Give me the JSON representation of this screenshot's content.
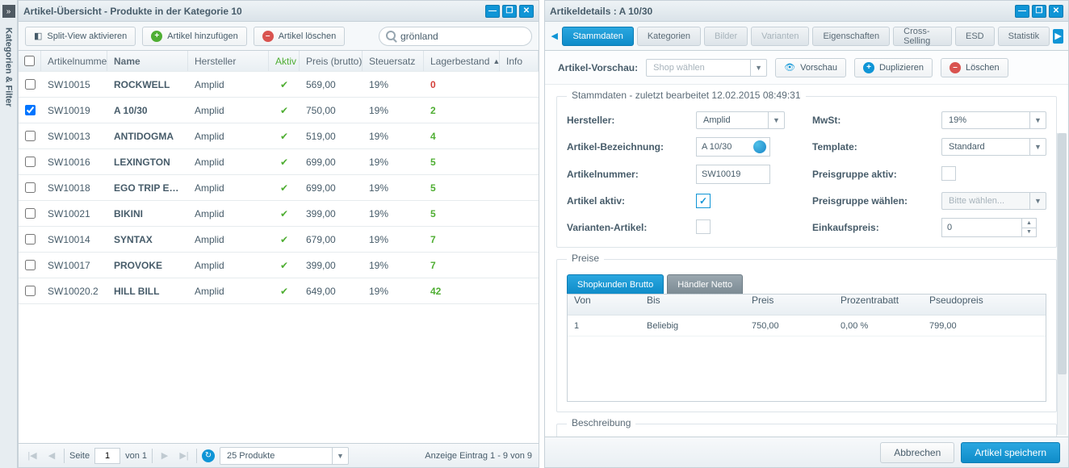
{
  "sidebar": {
    "label": "Kategorien & Filter"
  },
  "leftWindow": {
    "title": "Artikel-Übersicht - Produkte in der Kategorie 10",
    "toolbar": {
      "splitview": "Split-View aktivieren",
      "add": "Artikel hinzufügen",
      "delete": "Artikel löschen",
      "search_value": "grönland"
    },
    "columns": {
      "num": "Artikelnummer",
      "name": "Name",
      "her": "Hersteller",
      "aktiv": "Aktiv",
      "preis": "Preis (brutto)",
      "steuer": "Steuersatz",
      "lager": "Lagerbestand",
      "info": "Info"
    },
    "rows": [
      {
        "num": "SW10015",
        "name": "ROCKWELL",
        "her": "Amplid",
        "aktiv": true,
        "preis": "569,00",
        "steuer": "19%",
        "lager": "0",
        "stock": "red",
        "checked": false
      },
      {
        "num": "SW10019",
        "name": "A 10/30",
        "her": "Amplid",
        "aktiv": true,
        "preis": "750,00",
        "steuer": "19%",
        "lager": "2",
        "stock": "green",
        "checked": true
      },
      {
        "num": "SW10013",
        "name": "ANTIDOGMA",
        "her": "Amplid",
        "aktiv": true,
        "preis": "519,00",
        "steuer": "19%",
        "lager": "4",
        "stock": "green",
        "checked": false
      },
      {
        "num": "SW10016",
        "name": "LEXINGTON",
        "her": "Amplid",
        "aktiv": true,
        "preis": "699,00",
        "steuer": "19%",
        "lager": "5",
        "stock": "green",
        "checked": false
      },
      {
        "num": "SW10018",
        "name": "EGO TRIP EVO...",
        "her": "Amplid",
        "aktiv": true,
        "preis": "699,00",
        "steuer": "19%",
        "lager": "5",
        "stock": "green",
        "checked": false
      },
      {
        "num": "SW10021",
        "name": "BIKINI",
        "her": "Amplid",
        "aktiv": true,
        "preis": "399,00",
        "steuer": "19%",
        "lager": "5",
        "stock": "green",
        "checked": false
      },
      {
        "num": "SW10014",
        "name": "SYNTAX",
        "her": "Amplid",
        "aktiv": true,
        "preis": "679,00",
        "steuer": "19%",
        "lager": "7",
        "stock": "green",
        "checked": false
      },
      {
        "num": "SW10017",
        "name": "PROVOKE",
        "her": "Amplid",
        "aktiv": true,
        "preis": "399,00",
        "steuer": "19%",
        "lager": "7",
        "stock": "green",
        "checked": false
      },
      {
        "num": "SW10020.2",
        "name": "HILL BILL",
        "her": "Amplid",
        "aktiv": true,
        "preis": "649,00",
        "steuer": "19%",
        "lager": "42",
        "stock": "green",
        "checked": false
      }
    ],
    "pager": {
      "page_label": "Seite",
      "page": "1",
      "of": "von 1",
      "perpage": "25 Produkte",
      "status": "Anzeige Eintrag 1 - 9 von 9"
    }
  },
  "rightWindow": {
    "title": "Artikeldetails : A 10/30",
    "tabs": [
      "Stammdaten",
      "Kategorien",
      "Bilder",
      "Varianten",
      "Eigenschaften",
      "Cross-Selling",
      "ESD",
      "Statistik"
    ],
    "previewBar": {
      "label": "Artikel-Vorschau:",
      "shop_placeholder": "Shop wählen",
      "preview": "Vorschau",
      "duplicate": "Duplizieren",
      "delete": "Löschen"
    },
    "stammdaten": {
      "legend": "Stammdaten - zuletzt bearbeitet 12.02.2015 08:49:31",
      "labels": {
        "hersteller": "Hersteller:",
        "mwst": "MwSt:",
        "bezeichnung": "Artikel-Bezeichnung:",
        "template": "Template:",
        "artikelnummer": "Artikelnummer:",
        "preisgruppe_aktiv": "Preisgruppe aktiv:",
        "aktiv": "Artikel aktiv:",
        "preisgruppe_waehlen": "Preisgruppe wählen:",
        "varianten": "Varianten-Artikel:",
        "einkaufspreis": "Einkaufspreis:"
      },
      "values": {
        "hersteller": "Amplid",
        "mwst": "19%",
        "bezeichnung": "A 10/30",
        "template": "Standard",
        "artikelnummer": "SW10019",
        "preisgruppe_waehlen": "Bitte wählen...",
        "einkaufspreis": "0"
      }
    },
    "preise": {
      "legend": "Preise",
      "tabs": {
        "brutto": "Shopkunden Brutto",
        "netto": "Händler Netto"
      },
      "cols": {
        "von": "Von",
        "bis": "Bis",
        "preis": "Preis",
        "rabatt": "Prozentrabatt",
        "pseudo": "Pseudopreis"
      },
      "row": {
        "von": "1",
        "bis": "Beliebig",
        "preis": "750,00",
        "rabatt": "0,00 %",
        "pseudo": "799,00"
      }
    },
    "beschreibung_legend": "Beschreibung",
    "footer": {
      "cancel": "Abbrechen",
      "save": "Artikel speichern"
    }
  }
}
